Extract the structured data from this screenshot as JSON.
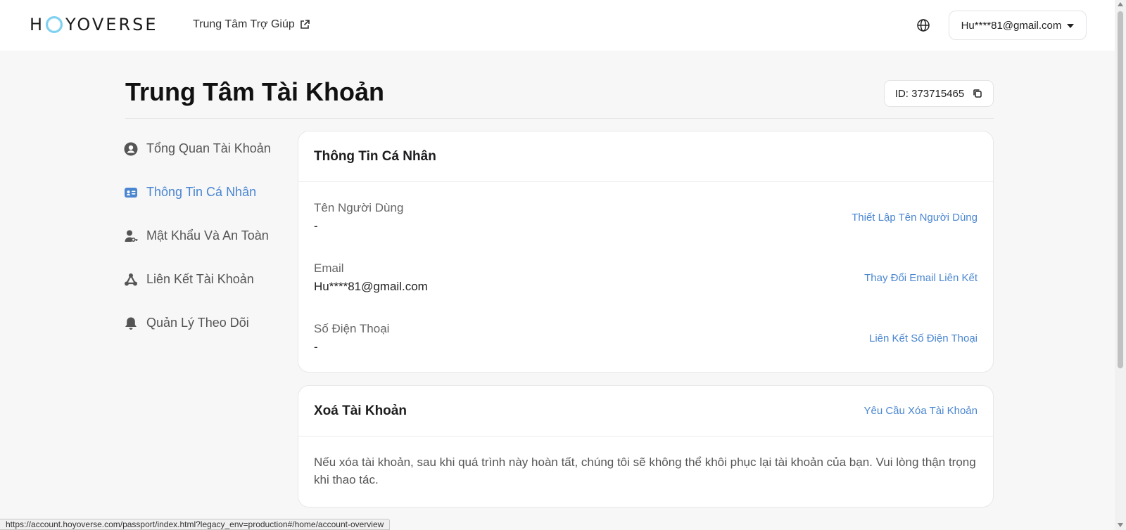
{
  "header": {
    "logo_left": "H",
    "logo_right": "YOVERSE",
    "help_label": "Trung Tâm Trợ Giúp",
    "account_label": "Hu****81@gmail.com"
  },
  "page": {
    "title": "Trung Tâm Tài Khoản",
    "id_label": "ID: 373715465"
  },
  "sidebar": {
    "items": [
      {
        "label": "Tổng Quan Tài Khoản",
        "icon": "user-circle-icon"
      },
      {
        "label": "Thông Tin Cá Nhân",
        "icon": "id-card-icon",
        "active": true
      },
      {
        "label": "Mật Khẩu Và An Toàn",
        "icon": "user-lock-icon"
      },
      {
        "label": "Liên Kết Tài Khoản",
        "icon": "link-nodes-icon"
      },
      {
        "label": "Quản Lý Theo Dõi",
        "icon": "bell-icon"
      }
    ]
  },
  "personal_info": {
    "title": "Thông Tin Cá Nhân",
    "rows": [
      {
        "label": "Tên Người Dùng",
        "value": "-",
        "action": "Thiết Lập Tên Người Dùng"
      },
      {
        "label": "Email",
        "value": "Hu****81@gmail.com",
        "action": "Thay Đổi Email Liên Kết"
      },
      {
        "label": "Số Điện Thoại",
        "value": "-",
        "action": "Liên Kết Số Điện Thoại"
      }
    ]
  },
  "delete_account": {
    "title": "Xoá Tài Khoản",
    "action": "Yêu Cầu Xóa Tài Khoản",
    "text": "Nếu xóa tài khoản, sau khi quá trình này hoàn tất, chúng tôi sẽ không thể khôi phục lại tài khoản của bạn. Vui lòng thận trọng khi thao tác."
  },
  "status_bar": {
    "url": "https://account.hoyoverse.com/passport/index.html?legacy_env=production#/home/account-overview"
  },
  "colors": {
    "accent": "#4a86d0",
    "background": "#f7f7f8",
    "logo_ring": "#7fd0f0"
  }
}
